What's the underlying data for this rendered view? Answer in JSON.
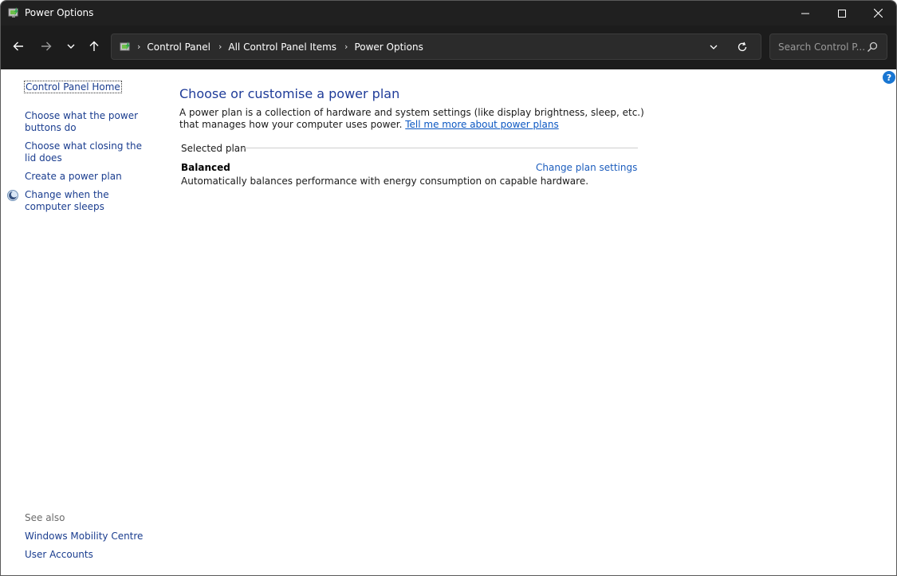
{
  "window": {
    "title": "Power Options"
  },
  "nav": {
    "breadcrumbs": [
      "Control Panel",
      "All Control Panel Items",
      "Power Options"
    ],
    "search_placeholder": "Search Control P..."
  },
  "sidebar": {
    "home_link": "Control Panel Home",
    "tasks": [
      "Choose what the power buttons do",
      "Choose what closing the lid does",
      "Create a power plan",
      "Change when the computer sleeps"
    ],
    "see_also_label": "See also",
    "see_also_links": [
      "Windows Mobility Centre",
      "User Accounts"
    ]
  },
  "main": {
    "title": "Choose or customise a power plan",
    "description": "A power plan is a collection of hardware and system settings (like display brightness, sleep, etc.) that manages how your computer uses power.",
    "learn_more_link": "Tell me more about power plans",
    "selected_plan_label": "Selected plan",
    "plan": {
      "name": "Balanced",
      "description": "Automatically balances performance with energy consumption on capable hardware.",
      "change_link": "Change plan settings"
    },
    "help_glyph": "?"
  },
  "colors": {
    "titlebar": "#202020",
    "navbar": "#1c1c1c",
    "link": "#1c3a70",
    "title_blue": "#1f3c99",
    "help_blue": "#1976d2"
  }
}
